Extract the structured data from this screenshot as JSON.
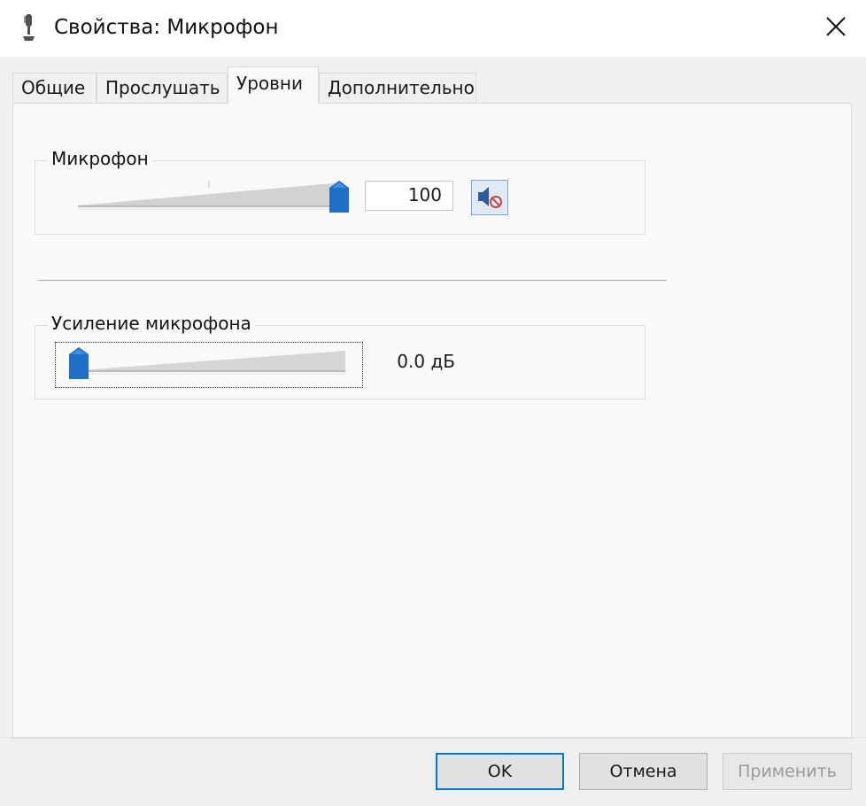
{
  "window": {
    "title": "Свойства: Микрофон"
  },
  "tabs": [
    {
      "label": "Общие"
    },
    {
      "label": "Прослушать"
    },
    {
      "label": "Уровни"
    },
    {
      "label": "Дополнительно"
    }
  ],
  "levels": {
    "microphone": {
      "label": "Микрофон",
      "value": "100",
      "level_percent": 100,
      "muted": false
    },
    "boost": {
      "label": "Усиление микрофона",
      "value": "0.0 дБ",
      "level_percent": 0
    }
  },
  "buttons": {
    "ok": "OK",
    "cancel": "Отмена",
    "apply": "Применить"
  },
  "colors": {
    "accent": "#0078d7",
    "thumb": "#1e6fc6"
  }
}
